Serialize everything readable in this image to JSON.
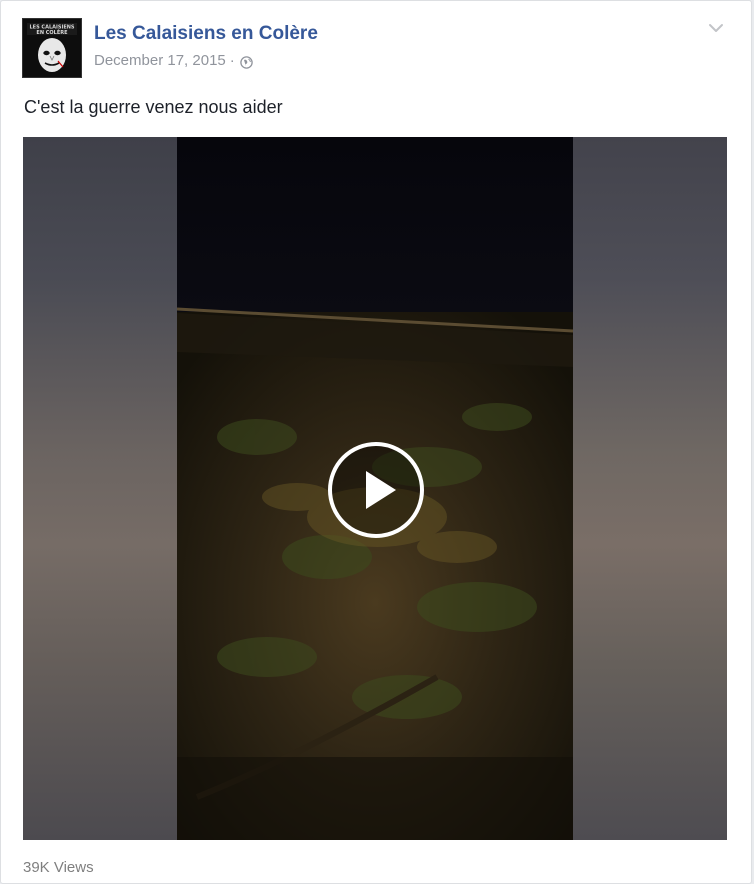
{
  "post": {
    "author": "Les Calaisiens en Colère",
    "date": "December 17, 2015",
    "separator": "·",
    "privacy_icon": "globe-icon",
    "menu_icon": "chevron-down-icon",
    "avatar_text_line1": "LES CALAISIENS",
    "avatar_text_line2": "EN COLÈRE",
    "text": "C'est la guerre venez nous aider"
  },
  "video": {
    "play_icon": "play-icon",
    "views": "39K Views"
  },
  "colors": {
    "link": "#365899",
    "meta": "#90949c",
    "text": "#1d2129",
    "card_border": "#dddfe2"
  }
}
